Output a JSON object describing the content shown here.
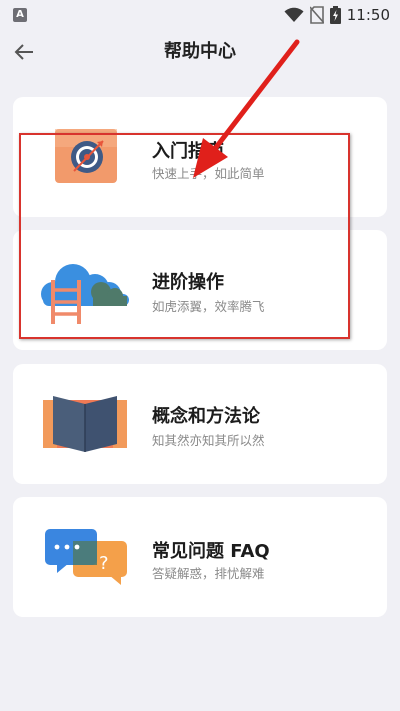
{
  "status_bar": {
    "app_icon_letter": "A",
    "time": "11:50",
    "icons": [
      "wifi-icon",
      "no-sim-icon",
      "battery-charging-icon"
    ]
  },
  "header": {
    "title": "帮助中心",
    "back_icon": "arrow-left-icon"
  },
  "cards": [
    {
      "title": "入门指南",
      "subtitle": "快速上手，如此简单",
      "icon": "target-dart-icon"
    },
    {
      "title": "进阶操作",
      "subtitle": "如虎添翼，效率腾飞",
      "icon": "ladder-cloud-icon"
    },
    {
      "title": "概念和方法论",
      "subtitle": "知其然亦知其所以然",
      "icon": "open-book-icon"
    },
    {
      "title": "常见问题 FAQ",
      "subtitle": "答疑解惑，排忧解难",
      "icon": "chat-bubbles-icon"
    }
  ],
  "annotation": {
    "highlight_color": "#D8332D",
    "arrow_color": "#E0201B"
  },
  "colors": {
    "background": "#F0F0F5",
    "card": "#FFFFFF",
    "title_text": "#1C1C1C",
    "subtitle_text": "#8A8A8A"
  }
}
